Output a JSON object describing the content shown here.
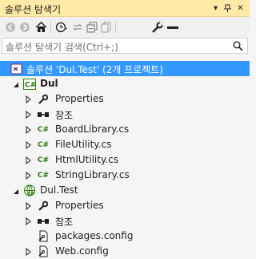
{
  "window": {
    "title": "솔루션 탐색기",
    "pin_icon": "pin-icon",
    "close_icon": "close-icon"
  },
  "toolbar": {
    "buttons": [
      "back-icon",
      "forward-icon",
      "home-icon",
      "history-icon",
      "sync-icon",
      "collapse-all-icon",
      "show-all-files-icon",
      "properties-icon",
      "minus-icon"
    ]
  },
  "search": {
    "placeholder": "솔루션 탐색기 검색(Ctrl+;)",
    "icon": "search-icon"
  },
  "tree": {
    "solution": "솔루션 'Dul.Test' (2개 프로젝트)",
    "project1": {
      "name": "Dul",
      "properties": "Properties",
      "references": "참조",
      "files": [
        "BoardLibrary.cs",
        "FileUtility.cs",
        "HtmlUtility.cs",
        "StringLibrary.cs"
      ]
    },
    "project2": {
      "name": "Dul.Test",
      "properties": "Properties",
      "references": "참조",
      "files": [
        "packages.config",
        "Web.config"
      ]
    }
  },
  "colors": {
    "title_bg": "#ffeaa6",
    "selection": "#3399ff",
    "csharp": "#2b7a0b"
  }
}
